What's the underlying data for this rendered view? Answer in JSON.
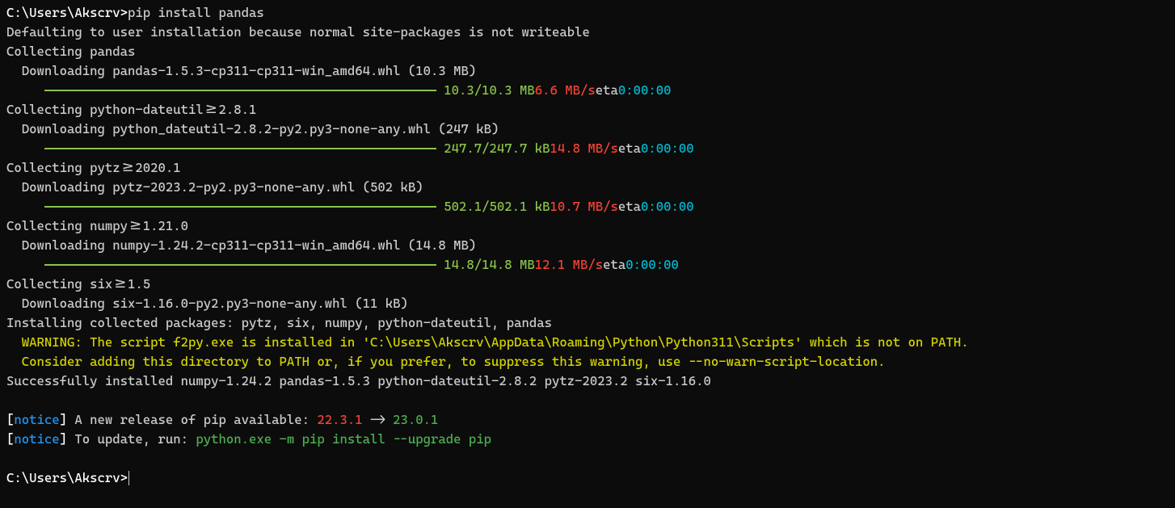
{
  "prompt1": "C:\\Users\\Akscrv>",
  "command": "pip install pandas",
  "defaulting": "Defaulting to user installation because normal site-packages is not writeable",
  "packages": [
    {
      "collecting": "Collecting pandas",
      "downloading": "Downloading pandas-1.5.3-cp311-cp311-win_amd64.whl (10.3 MB)",
      "progress": "10.3/10.3 MB",
      "speed": "6.6 MB/s",
      "eta_label": "eta",
      "eta": "0:00:00"
    },
    {
      "collecting": "Collecting python-dateutil>=2.8.1",
      "downloading": "Downloading python_dateutil-2.8.2-py2.py3-none-any.whl (247 kB)",
      "progress": "247.7/247.7 kB",
      "speed": "14.8 MB/s",
      "eta_label": "eta",
      "eta": "0:00:00"
    },
    {
      "collecting": "Collecting pytz>=2020.1",
      "downloading": "Downloading pytz-2023.2-py2.py3-none-any.whl (502 kB)",
      "progress": "502.1/502.1 kB",
      "speed": "10.7 MB/s",
      "eta_label": "eta",
      "eta": "0:00:00"
    },
    {
      "collecting": "Collecting numpy>=1.21.0",
      "downloading": "Downloading numpy-1.24.2-cp311-cp311-win_amd64.whl (14.8 MB)",
      "progress": "14.8/14.8 MB",
      "speed": "12.1 MB/s",
      "eta_label": "eta",
      "eta": "0:00:00"
    }
  ],
  "six": {
    "collecting": "Collecting six>=1.5",
    "downloading": "Downloading six-1.16.0-py2.py3-none-any.whl (11 kB)"
  },
  "installing": "Installing collected packages: pytz, six, numpy, python-dateutil, pandas",
  "warning1": "  WARNING: The script f2py.exe is installed in 'C:\\Users\\Akscrv\\AppData\\Roaming\\Python\\Python311\\Scripts' which is not on PATH.",
  "warning2": "  Consider adding this directory to PATH or, if you prefer, to suppress this warning, use --no-warn-script-location.",
  "success": "Successfully installed numpy-1.24.2 pandas-1.5.3 python-dateutil-2.8.2 pytz-2023.2 six-1.16.0",
  "notice1": {
    "bracket_open": "[",
    "notice": "notice",
    "bracket_close": "]",
    "text": " A new release of pip available: ",
    "old_ver": "22.3.1",
    "arrow": " -> ",
    "new_ver": "23.0.1"
  },
  "notice2": {
    "bracket_open": "[",
    "notice": "notice",
    "bracket_close": "]",
    "text": " To update, run: ",
    "cmd": "python.exe -m pip install --upgrade pip"
  },
  "prompt2": "C:\\Users\\Akscrv>"
}
